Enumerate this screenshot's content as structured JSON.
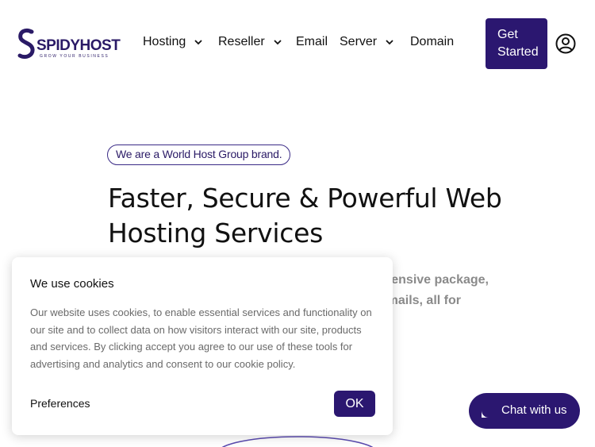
{
  "header": {
    "logo_text": "SPIDYHOST",
    "logo_tagline": "GROW YOUR BUSINESS",
    "nav": [
      {
        "label": "Hosting",
        "dropdown": true
      },
      {
        "label": "Reseller",
        "dropdown": true
      },
      {
        "label": "Email",
        "dropdown": false
      },
      {
        "label": "Server",
        "dropdown": true
      },
      {
        "label": "Domain",
        "dropdown": false
      }
    ],
    "cta_label": "Get Started"
  },
  "hero": {
    "brand_pill": "We are a World Host Group brand.",
    "title": "Faster, Secure & Powerful Web Hosting Services",
    "description_line1": "ensive package,",
    "description_line2": "mails, all for"
  },
  "cookie_banner": {
    "title": "We use cookies",
    "body": "Our website uses cookies, to enable essential services and functionality on our site and to collect data on how visitors interact with our site, products and services. By clicking accept you agree to our use of these tools for advertising and analytics and consent to our cookie policy.",
    "preferences_label": "Preferences",
    "ok_label": "OK"
  },
  "chat_widget": {
    "label": "Chat with us"
  },
  "colors": {
    "brand": "#2b1770",
    "text": "#111111",
    "muted": "#6a6a6a"
  },
  "icons": [
    "spidyhost-logo-icon",
    "chevron-down-icon",
    "account-circle-icon",
    "chat-bubble-icon"
  ]
}
